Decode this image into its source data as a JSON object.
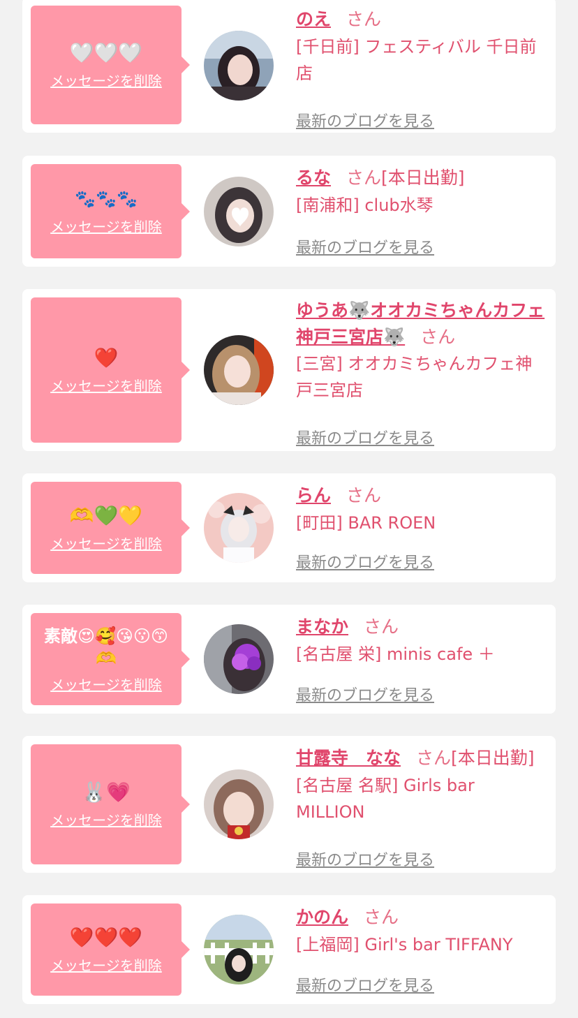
{
  "delete_label": "メッセージを削除",
  "blog_label": "最新のブログを見る",
  "san_suffix": "さん",
  "colors": {
    "accent": "#e0456b",
    "bubble": "#ff98a8",
    "background": "#f2f2f2"
  },
  "cards": [
    {
      "name": "のえ",
      "status": "",
      "shop": "[千日前] フェスティバル 千日前店",
      "message": "🤍🤍🤍",
      "avatar_icon": "girl-photo"
    },
    {
      "name": "るな",
      "status": "[本日出勤]",
      "shop": "[南浦和] club水琴",
      "message": "🐾🐾🐾",
      "avatar_icon": "girl-photo-heart-mask"
    },
    {
      "name": "ゆうあ🐺オオカミちゃんカフェ神戸三宮店🐺",
      "status": "",
      "shop": "[三宮] オオカミちゃんカフェ神戸三宮店",
      "message": "❤️",
      "avatar_icon": "girl-photo"
    },
    {
      "name": "らん",
      "status": "",
      "shop": "[町田] BAR ROEN",
      "message": "🫶💚💛",
      "avatar_icon": "girl-photo-flowers"
    },
    {
      "name": "まなか",
      "status": "",
      "shop": "[名古屋 栄] minis cafe ＋",
      "message": "素敵😍🥰😘😗😙🫶",
      "avatar_icon": "girl-photo-blurred"
    },
    {
      "name": "甘露寺　なな",
      "status": "[本日出勤]",
      "shop": "[名古屋 名駅] Girls bar MILLION",
      "message": "🐰💗",
      "avatar_icon": "girl-photo"
    },
    {
      "name": "かのん",
      "status": "",
      "shop": "[上福岡] Girl's bar TIFFANY",
      "message": "❤️❤️❤️",
      "avatar_icon": "girl-photo-outdoor"
    }
  ]
}
